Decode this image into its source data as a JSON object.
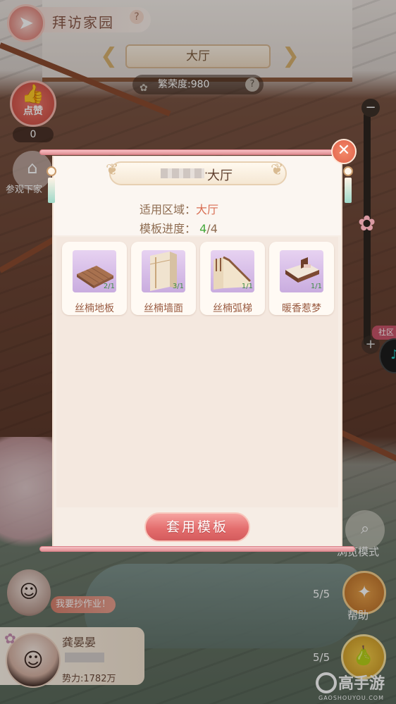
{
  "header": {
    "title": "拜访家园",
    "help": "?"
  },
  "room_selector": {
    "name": "大厅",
    "prosperity": "繁荣度:980",
    "help": "?"
  },
  "left_panel": {
    "like_label": "点赞",
    "like_count": "0",
    "visit_label": "参观下家"
  },
  "right_panel": {
    "community_label": "社区",
    "preview_label": "浏览模式",
    "help_label": "帮助",
    "count1": "5/5",
    "count2": "5/5"
  },
  "profile": {
    "homework_label": "我要抄作业！",
    "name": "龚晏晏",
    "power": "势力:1782万"
  },
  "modal": {
    "title_suffix": "大厅",
    "area_label": "适用区域：",
    "area_value": "大厅",
    "progress_label": "模板进度：",
    "progress_current": "4",
    "progress_total": "/4",
    "items": [
      {
        "name": "丝楠地板",
        "count": "2/1",
        "icon": "floor-icon"
      },
      {
        "name": "丝楠墙面",
        "count": "3/1",
        "icon": "wall-icon"
      },
      {
        "name": "丝楠弧梯",
        "count": "1/1",
        "icon": "stairs-icon"
      },
      {
        "name": "暖香惹梦",
        "count": "1/1",
        "icon": "bed-icon"
      }
    ],
    "apply_label": "套用模板"
  },
  "watermark": {
    "text": "高手游",
    "url": "GAOSHOUYOU.COM"
  },
  "colors": {
    "accent": "#e46e6e",
    "progress_green": "#44a83a",
    "area_orange": "#d86d52"
  }
}
